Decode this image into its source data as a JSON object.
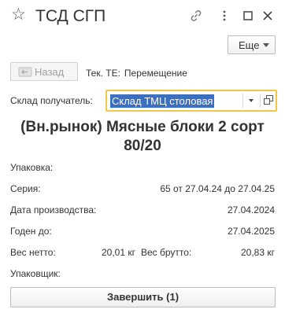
{
  "window": {
    "title": "ТСД СГП"
  },
  "toolbar": {
    "more_label": "Еще",
    "back_label": "Назад",
    "te_label": "Тек. ТЕ:",
    "te_value": "Перемещение"
  },
  "warehouse": {
    "label": "Склад получатель:",
    "value": "Склад ТМЦ столовая"
  },
  "product": {
    "name": "(Вн.рынок) Мясные блоки 2 сорт 80/20"
  },
  "info": {
    "packaging_label": "Упаковка:",
    "series_label": "Серия:",
    "series_value": "65 от 27.04.24 до 27.04.25",
    "production_date_label": "Дата производства:",
    "production_date_value": "27.04.2024",
    "expiry_label": "Годен до:",
    "expiry_value": "27.04.2025",
    "net_weight_label": "Вес нетто:",
    "net_weight_value": "20,01 кг",
    "gross_weight_label": "Вес брутто:",
    "gross_weight_value": "20,83 кг",
    "packer_label": "Упаковщик:"
  },
  "actions": {
    "finish_label": "Завершить (1)"
  },
  "icons": {
    "star": "star-icon",
    "link": "link-icon",
    "more": "more-vertical-icon",
    "maximize": "maximize-icon",
    "close": "close-icon",
    "back": "arrow-left-icon",
    "dropdown": "chevron-down-icon",
    "open": "open-form-icon"
  },
  "colors": {
    "selection": "#3b6fbf",
    "focus_border": "#f0c74a",
    "text": "#333333"
  }
}
